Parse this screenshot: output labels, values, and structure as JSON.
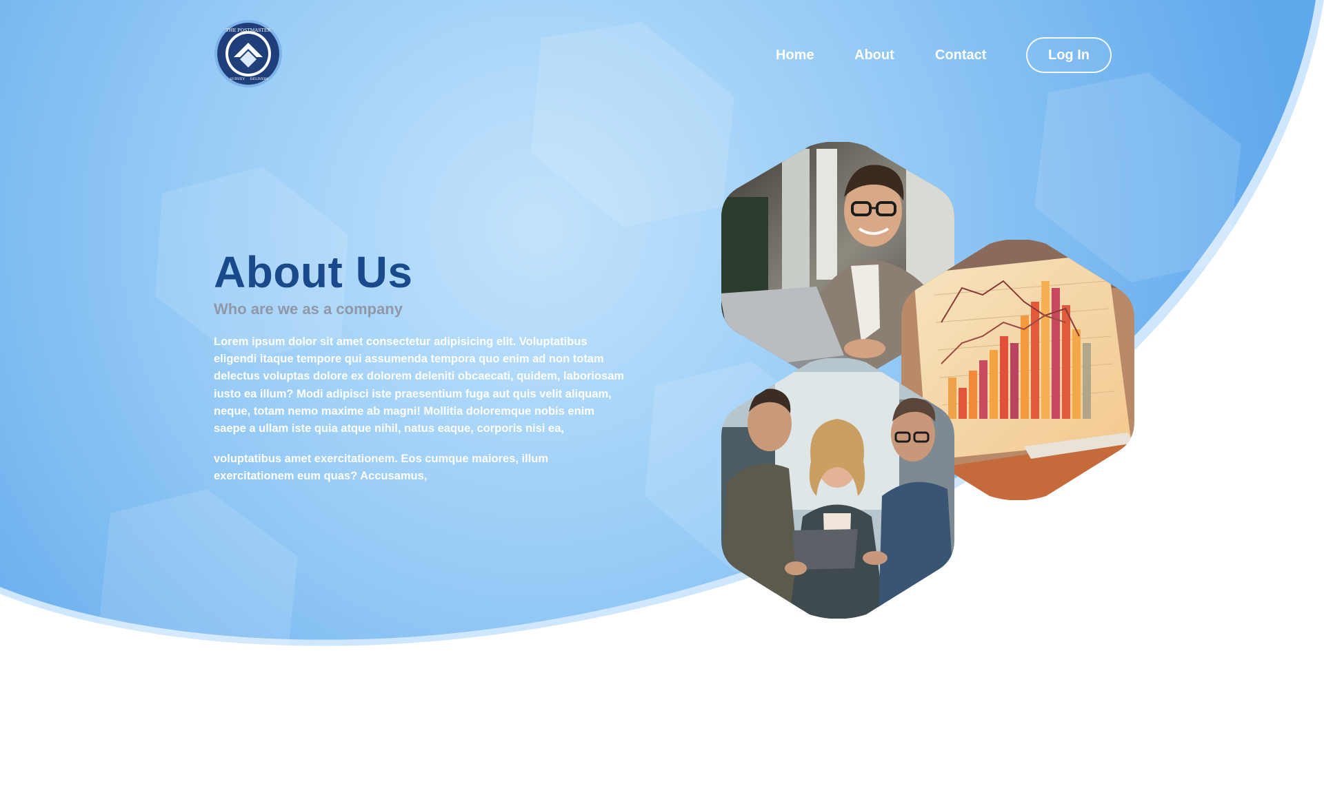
{
  "brand": {
    "logo_alt": "The Postmaster logo",
    "logo_text_top": "THE POSTMASTER",
    "logo_text_bottom_left": "SURVEY",
    "logo_text_bottom_right": "DELIVERY"
  },
  "nav": {
    "items": [
      {
        "label": "Home"
      },
      {
        "label": "About"
      },
      {
        "label": "Contact"
      }
    ],
    "login_label": "Log In"
  },
  "hero": {
    "title": "About Us",
    "subtitle": "Who are we as a company",
    "paragraphs": [
      "Lorem ipsum dolor sit amet consectetur adipisicing elit. Voluptatibus eligendi itaque tempore qui assumenda tempora quo enim ad non totam delectus voluptas dolore ex dolorem deleniti obcaecati, quidem, laboriosam iusto ea illum? Modi adipisci iste praesentium fuga aut quis velit aliquam, neque, totam nemo maxime ab magni! Mollitia doloremque nobis enim saepe a ullam iste quia atque nihil, natus eaque, corporis nisi ea,",
      "voluptatibus amet exercitationem. Eos cumque maiores, illum exercitationem eum quas? Accusamus,"
    ]
  },
  "images": [
    {
      "name": "man-with-laptop",
      "alt": "Smiling man working on a laptop"
    },
    {
      "name": "bar-chart-report",
      "alt": "Printed bar chart report"
    },
    {
      "name": "team-with-tablet",
      "alt": "Three colleagues looking at a tablet"
    }
  ],
  "colors": {
    "hero_blue_light": "#bfe0fb",
    "hero_blue_dark": "#6db3ef",
    "title_navy": "#1a4a8c",
    "subtitle_gray": "#8f98a8",
    "logo_navy": "#1e3f7a"
  }
}
